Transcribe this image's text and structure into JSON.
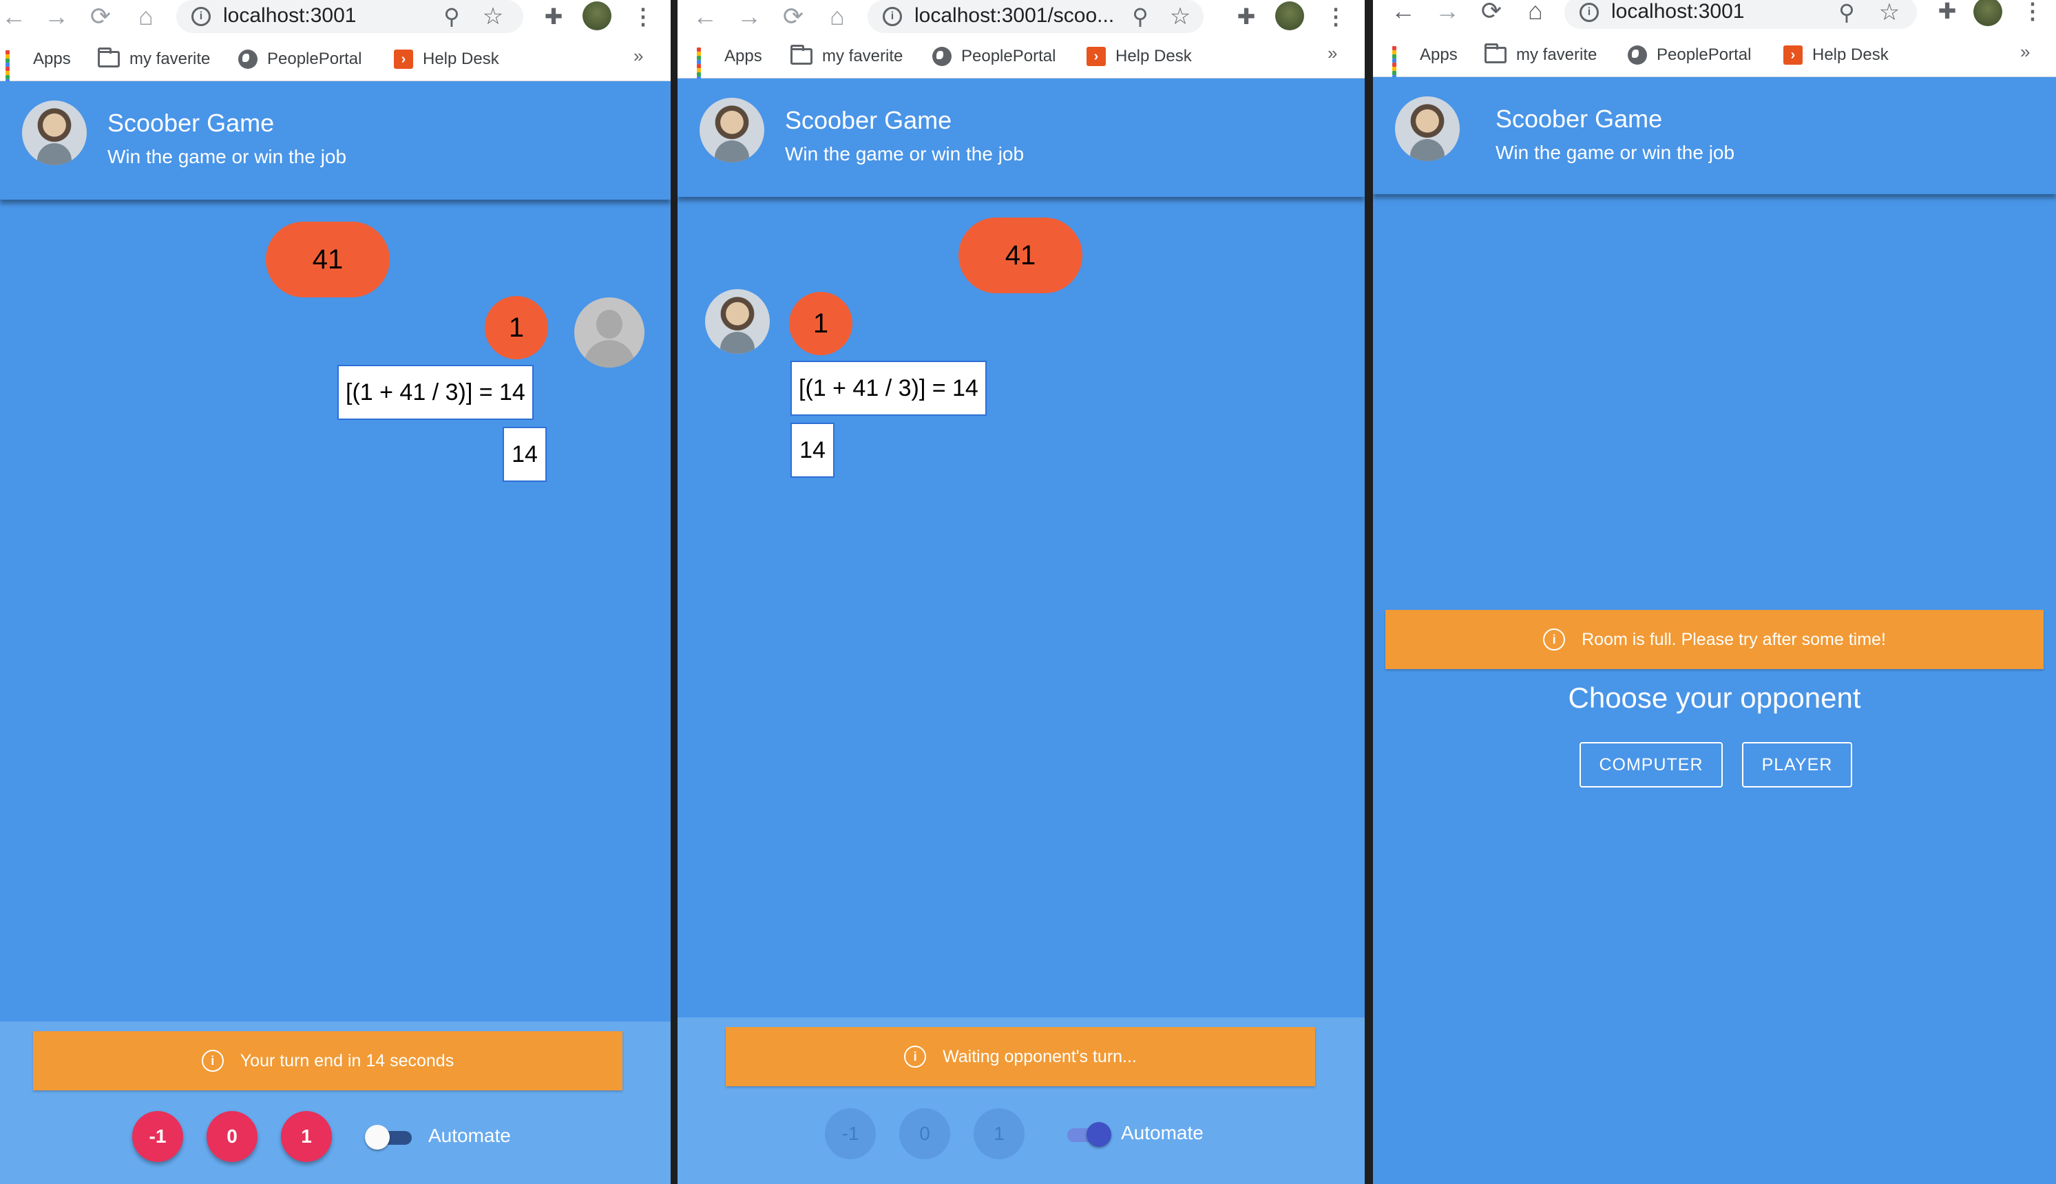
{
  "browser": {
    "nav_icons": {
      "back": "←",
      "forward": "→",
      "reload": "⟳",
      "home": "⌂"
    },
    "zoom_icon": "⚲",
    "star_icon": "☆",
    "extension_icon": "✚",
    "menu_icon": "⋮",
    "info_icon": "i",
    "bookmarks": [
      {
        "label": "Apps",
        "icon": "apps-grid-icon"
      },
      {
        "label": "my faverite",
        "icon": "folder-icon"
      },
      {
        "label": "PeoplePortal",
        "icon": "globe-icon"
      },
      {
        "label": "Help Desk",
        "icon": "helpdesk-icon"
      }
    ],
    "bookmarks_more": "»"
  },
  "app": {
    "title": "Scoober Game",
    "subtitle": "Win the game or win the job"
  },
  "panes": [
    {
      "url": "localhost:3001",
      "start_number": "41",
      "move": "1",
      "calculation": "[(1 + 41 / 3)] = 14",
      "result": "14",
      "alert": "Your turn end in 14 seconds",
      "buttons": [
        "-1",
        "0",
        "1"
      ],
      "buttons_enabled": true,
      "automate_label": "Automate",
      "automate_on": false
    },
    {
      "url": "localhost:3001/scoo...",
      "start_number": "41",
      "move": "1",
      "calculation": "[(1 + 41 / 3)] = 14",
      "result": "14",
      "alert": "Waiting opponent's turn...",
      "buttons": [
        "-1",
        "0",
        "1"
      ],
      "buttons_enabled": false,
      "automate_label": "Automate",
      "automate_on": true
    },
    {
      "url": "localhost:3001",
      "alert": "Room is full. Please try after some time!",
      "choose_title": "Choose your opponent",
      "options": [
        "COMPUTER",
        "PLAYER"
      ]
    }
  ],
  "colors": {
    "app_blue": "#4995e8",
    "footer_blue": "#67aaee",
    "accent_orange": "#f15e35",
    "alert_orange": "#f29a35",
    "button_pink": "#e8305a"
  }
}
